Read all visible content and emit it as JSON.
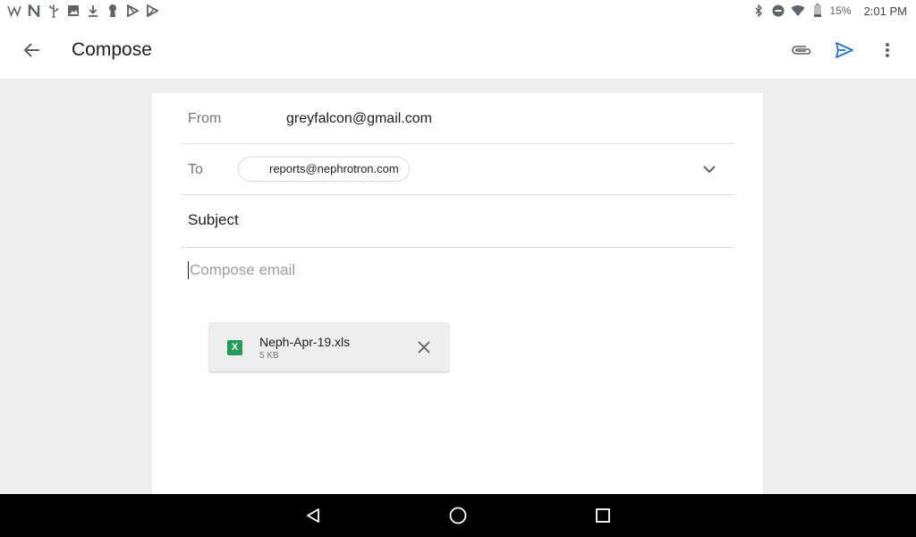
{
  "status_bar": {
    "left_icons": [
      "wikipedia-icon",
      "n-app-icon",
      "usb-icon",
      "image-icon",
      "download-icon",
      "keyhole-icon",
      "play-store-icon",
      "play-store-outline-icon"
    ],
    "battery_text": "15%",
    "time": "2:01 PM"
  },
  "app_bar": {
    "title": "Compose"
  },
  "compose": {
    "from_label": "From",
    "from_value": "greyfalcon@gmail.com",
    "to_label": "To",
    "to_chip": "reports@nephrotron.com",
    "subject_placeholder": "Subject",
    "body_placeholder": "Compose email"
  },
  "attachment": {
    "icon_letter": "X",
    "file_name": "Neph-Apr-19.xls",
    "file_size": "5 KB"
  },
  "colors": {
    "accent": "#1a73e8",
    "excel_green": "#1f9d55",
    "background": "#eeeeee"
  }
}
